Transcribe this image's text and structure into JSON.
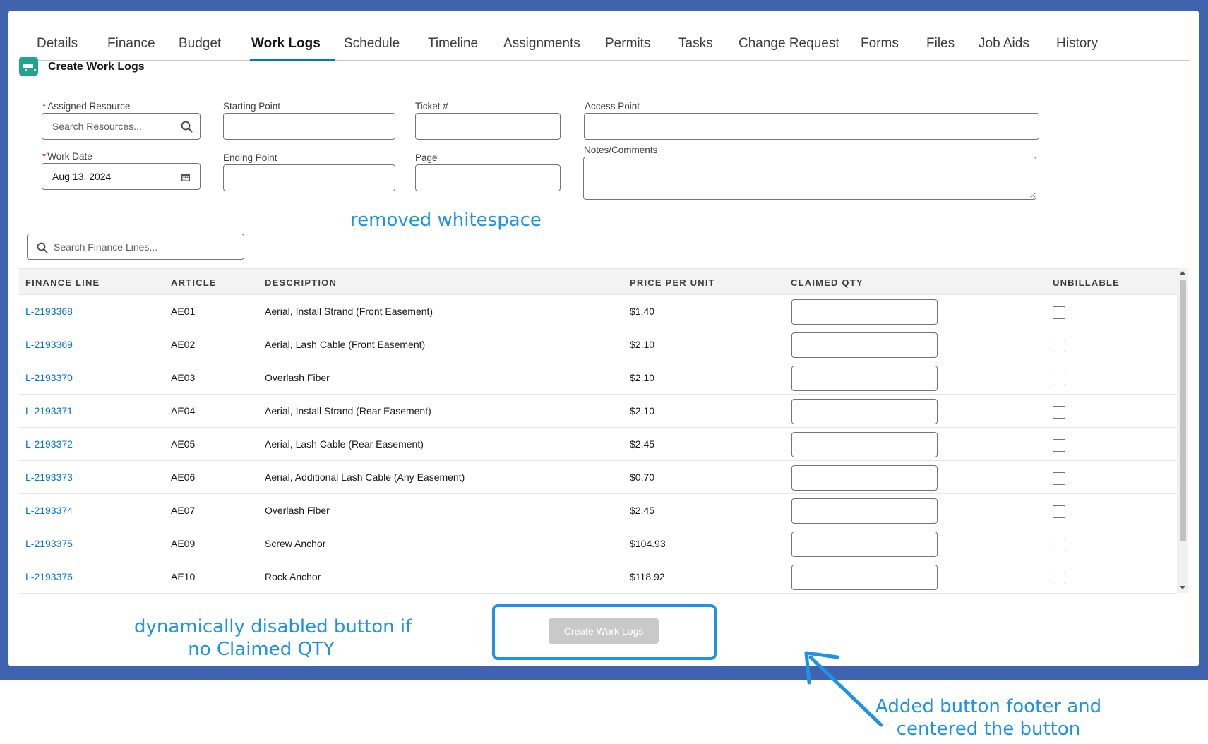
{
  "tabs": [
    "Details",
    "Finance",
    "Budget",
    "Work Logs",
    "Schedule",
    "Timeline",
    "Assignments",
    "Permits",
    "Tasks",
    "Change Request",
    "Forms",
    "Files",
    "Job Aids",
    "History"
  ],
  "active_tab": "Work Logs",
  "header": {
    "title": "Create Work Logs"
  },
  "form": {
    "assigned_resource": {
      "label": "Assigned Resource",
      "placeholder": "Search Resources..."
    },
    "work_date": {
      "label": "Work Date",
      "value": "Aug 13, 2024"
    },
    "starting_point": {
      "label": "Starting Point",
      "value": ""
    },
    "ending_point": {
      "label": "Ending Point",
      "value": ""
    },
    "ticket": {
      "label": "Ticket #",
      "value": ""
    },
    "page": {
      "label": "Page",
      "value": ""
    },
    "access_point": {
      "label": "Access Point",
      "value": ""
    },
    "notes": {
      "label": "Notes/Comments",
      "value": ""
    }
  },
  "search_finance": {
    "placeholder": "Search Finance Lines..."
  },
  "table": {
    "columns": [
      "FINANCE LINE",
      "ARTICLE",
      "DESCRIPTION",
      "PRICE PER UNIT",
      "CLAIMED QTY",
      "UNBILLABLE"
    ],
    "rows": [
      {
        "line": "L-2193368",
        "article": "AE01",
        "description": "Aerial, Install Strand (Front Easement)",
        "price": "$1.40"
      },
      {
        "line": "L-2193369",
        "article": "AE02",
        "description": "Aerial, Lash Cable (Front Easement)",
        "price": "$2.10"
      },
      {
        "line": "L-2193370",
        "article": "AE03",
        "description": "Overlash Fiber",
        "price": "$2.10"
      },
      {
        "line": "L-2193371",
        "article": "AE04",
        "description": "Aerial, Install Strand (Rear Easement)",
        "price": "$2.10"
      },
      {
        "line": "L-2193372",
        "article": "AE05",
        "description": "Aerial, Lash Cable (Rear Easement)",
        "price": "$2.45"
      },
      {
        "line": "L-2193373",
        "article": "AE06",
        "description": "Aerial, Additional Lash Cable (Any Easement)",
        "price": "$0.70"
      },
      {
        "line": "L-2193374",
        "article": "AE07",
        "description": "Overlash Fiber",
        "price": "$2.45"
      },
      {
        "line": "L-2193375",
        "article": "AE09",
        "description": "Screw Anchor",
        "price": "$104.93"
      },
      {
        "line": "L-2193376",
        "article": "AE10",
        "description": "Rock Anchor",
        "price": "$118.92"
      }
    ]
  },
  "button": {
    "label": "Create Work Logs",
    "disabled": true
  },
  "annotations": {
    "whitespace": "removed whitespace",
    "disabled_line1": "dynamically disabled button if",
    "disabled_line2": "no Claimed QTY",
    "footer_line1": "Added button footer and",
    "footer_line2": "centered the button"
  },
  "colors": {
    "accent": "#0176d3",
    "annotation": "#1e93e6",
    "band": "#3f63ad",
    "icon_bg": "#1fa58d"
  }
}
